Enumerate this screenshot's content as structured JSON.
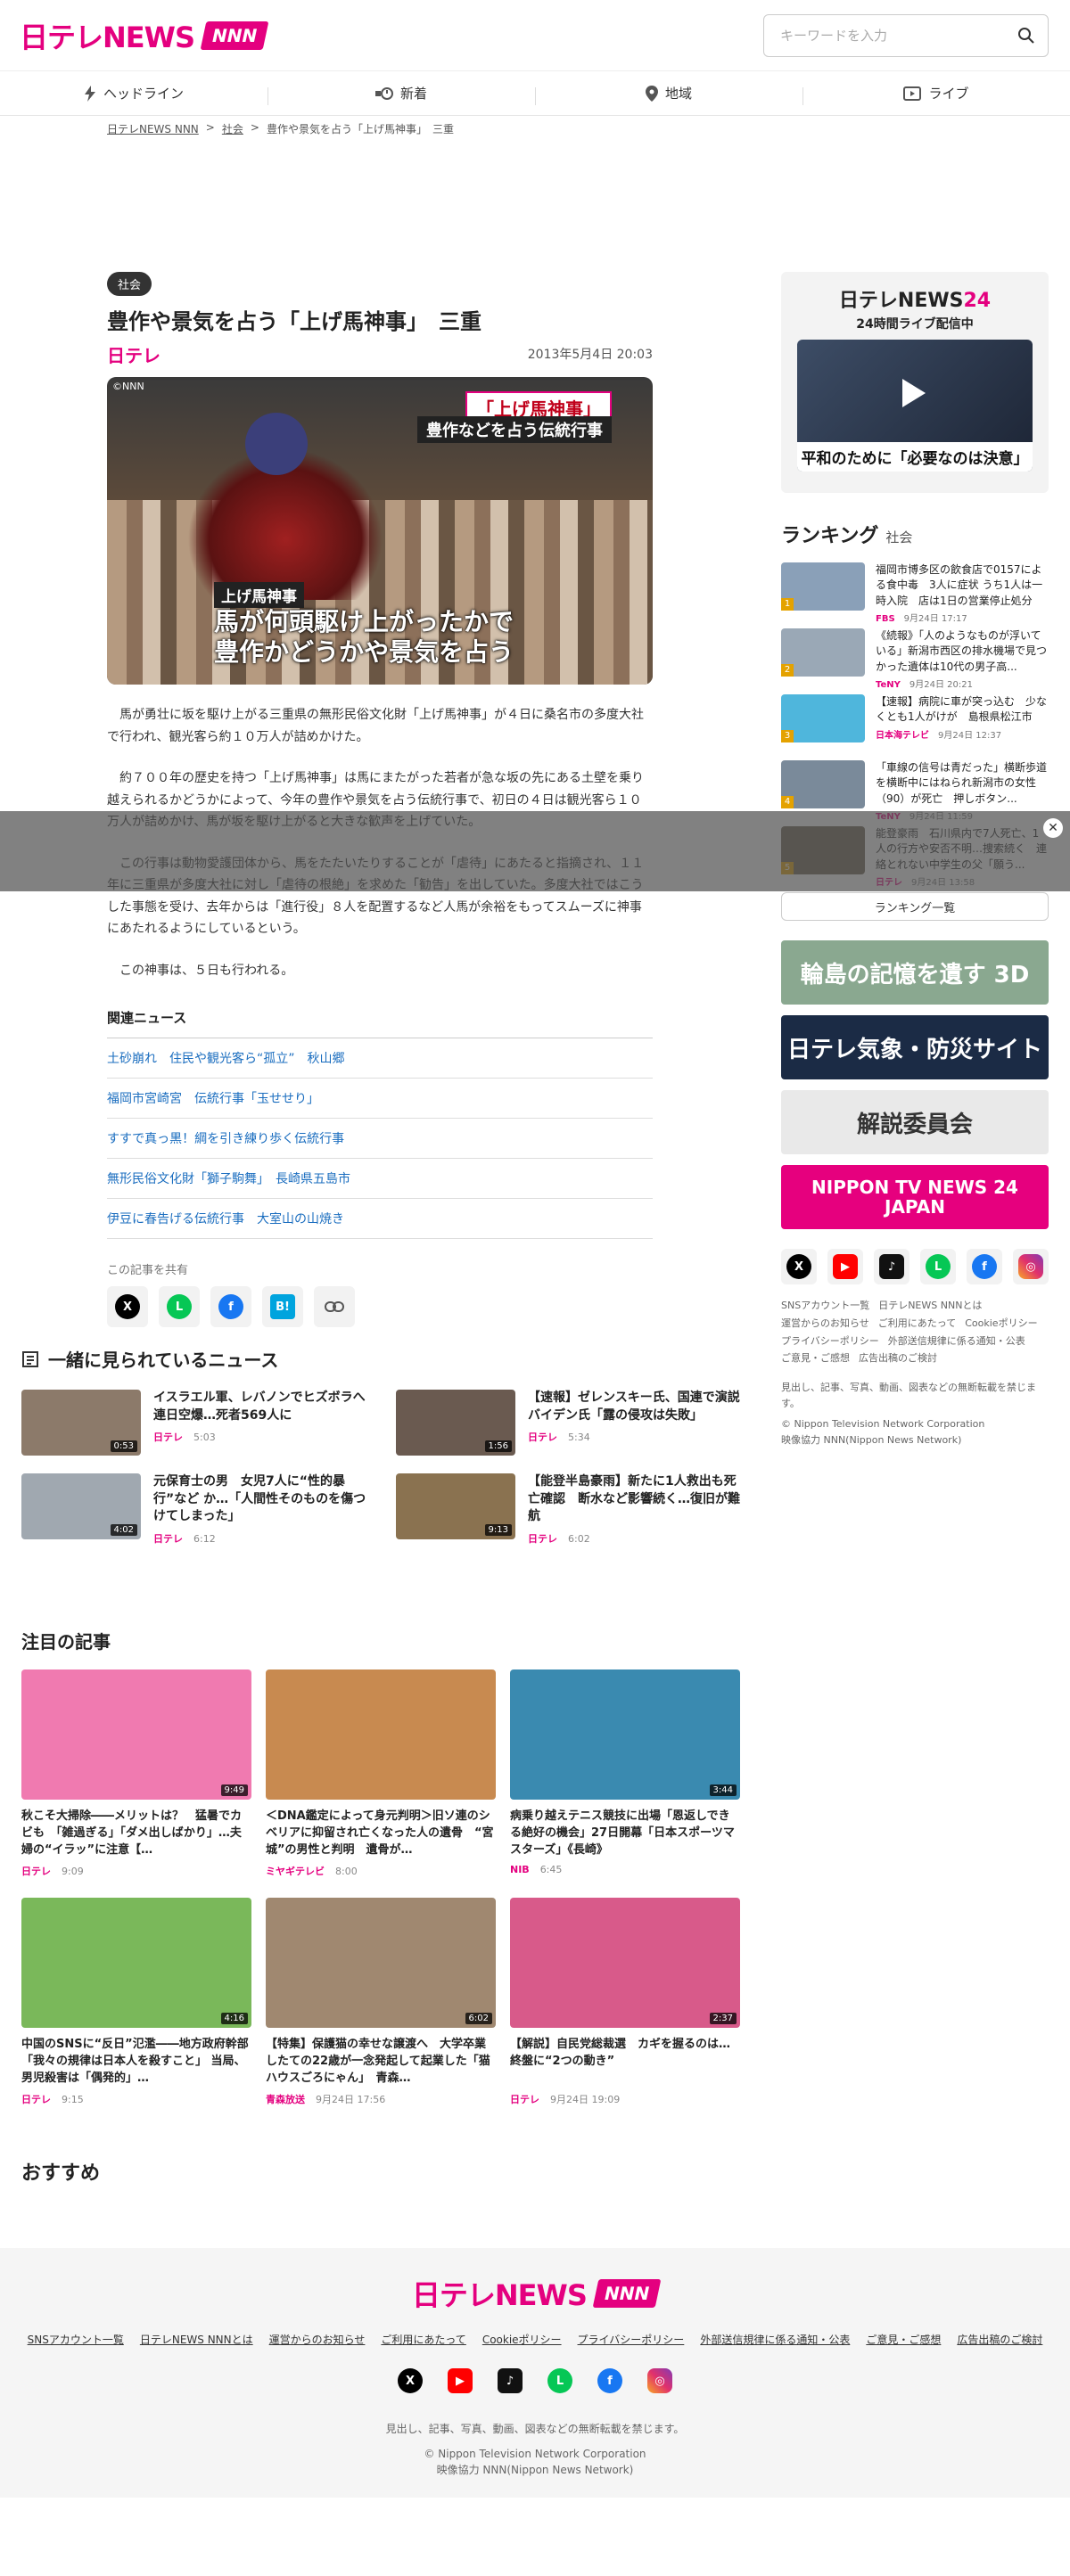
{
  "header": {
    "logo_main": "日テレNEWS",
    "logo_badge": "NNN",
    "search_placeholder": "キーワードを入力"
  },
  "nav": [
    {
      "label": "ヘッドライン",
      "icon": "lightning-icon"
    },
    {
      "label": "新着",
      "icon": "new-clock-icon"
    },
    {
      "label": "地域",
      "icon": "map-pin-icon"
    },
    {
      "label": "ライブ",
      "icon": "live-play-icon"
    }
  ],
  "breadcrumb": [
    "日テレNEWS NNN",
    "社会",
    "豊作や景気を占う「上げ馬神事」　三重"
  ],
  "article": {
    "category": "社会",
    "title": "豊作や景気を占う「上げ馬神事」　三重",
    "source_logo": "日テレ",
    "date": "2013年5月4日 20:03",
    "photo": {
      "watermark": "©NNN",
      "caption_top1": "「上げ馬神事」",
      "caption_top2": "豊作などを占う伝統行事",
      "caption_label": "上げ馬神事",
      "caption_main_1": "馬が何頭駆け上がったかで",
      "caption_main_2": "豊作かどうかや景気を占う"
    },
    "paragraphs": [
      "馬が勇壮に坂を駆け上がる三重県の無形民俗文化財「上げ馬神事」が４日に桑名市の多度大社で行われ、観光客ら約１０万人が詰めかけた。",
      "約７００年の歴史を持つ「上げ馬神事」は馬にまたがった若者が急な坂の先にある土壁を乗り越えられるかどうかによって、今年の豊作や景気を占う伝統行事で、初日の４日は観光客ら１０万人が詰めかけ、馬が坂を駆け上がると大きな歓声を上げていた。",
      "この行事は動物愛護団体から、馬をたたいたりすることが「虐待」にあたると指摘され、１１年に三重県が多度大社に対し「虐待の根絶」を求めた「勧告」を出していた。多度大社ではこうした事態を受け、去年からは「進行役」８人を配置するなど人馬が余裕をもってスムーズに神事にあたれるようにしているという。",
      "この神事は、５日も行われる。"
    ],
    "related_title": "関連ニュース",
    "related": [
      "土砂崩れ　住民や観光客ら“孤立”　秋山郷",
      "福岡市宮崎宮　伝統行事「玉せせり」",
      "すすで真っ黒！綱を引き練り歩く伝統行事",
      "無形民俗文化財「獅子駒舞」　長崎県五島市",
      "伊豆に春告げる伝統行事　大室山の山焼き"
    ],
    "share_label": "この記事を共有"
  },
  "sidebar": {
    "live_title_a": "日テレNEWS",
    "live_title_b": "24",
    "live_sub": "24時間ライブ配信中",
    "live_caption": "平和のために「必要なのは決意」",
    "ranking_title": "ランキング",
    "ranking_cat": "社会",
    "ranking": [
      {
        "no": "1",
        "text": "福岡市博多区の飲食店で0157による食中毒　3人に症状 うち1人は一時入院　店は1日の営業停止処分",
        "src": "FBS",
        "time": "9月24日 17:17",
        "color": "#8aa0b8"
      },
      {
        "no": "2",
        "text": "《続報》「人のようなものが浮いている」新潟市西区の排水機場で見つかった遺体は10代の男子高...",
        "src": "TeNY",
        "time": "9月24日 20:21",
        "color": "#9aa8b6"
      },
      {
        "no": "3",
        "text": "【速報】病院に車が突っ込む　少なくとも1人がけが　島根県松江市",
        "src": "日本海テレビ",
        "time": "9月24日 12:37",
        "color": "#4fb6dc"
      },
      {
        "no": "4",
        "text": "「車線の信号は青だった」横断歩道を横断中にはねられ新潟市の女性（90）が死亡　押しボタン...",
        "src": "TeNY",
        "time": "9月24日 11:59",
        "color": "#7a8a9a"
      },
      {
        "no": "5",
        "text": "能登豪雨　石川県内で7人死亡、1人の行方や安否不明…捜索続く　連絡とれない中学生の父「願う...",
        "src": "日テレ",
        "time": "9月24日 13:58",
        "color": "#6b6050"
      }
    ],
    "ranking_btn": "ランキング一覧",
    "banners": [
      {
        "label": "輪島の記憶を遺す 3D",
        "bg": "#8aa890",
        "fg": "#ffffff"
      },
      {
        "label": "日テレ気象・防災サイト",
        "bg": "#1b2b45",
        "fg": "#ffffff"
      },
      {
        "label": "解説委員会",
        "bg": "#e9e9e9",
        "fg": "#333333"
      },
      {
        "label": "NIPPON TV NEWS 24 JAPAN",
        "bg": "#e6007e",
        "fg": "#ffffff"
      }
    ],
    "links": [
      "SNSアカウント一覧",
      "日テレNEWS NNNとは",
      "運営からのお知らせ",
      "ご利用にあたって",
      "Cookieポリシー",
      "プライバシーポリシー",
      "外部送信規律に係る通知・公表",
      "ご意見・ご感想",
      "広告出稿のご検討"
    ],
    "notice": "見出し、記事、写真、動画、図表などの無断転載を禁じます。",
    "copyright_1": "© Nippon Television Network Corporation",
    "copyright_2": "映像協力 NNN(Nippon News Network)"
  },
  "together": {
    "title": "一緒に見られているニュース",
    "items": [
      {
        "text": "イスラエル軍、レバノンでヒズボラへ連日空爆…死者569人に",
        "src": "日テレ",
        "time": "5:03",
        "dur": "0:53",
        "color": "#8c7a6a"
      },
      {
        "text": "【速報】ゼレンスキー氏、国連で演説　バイデン氏「露の侵攻は失敗」",
        "src": "日テレ",
        "time": "5:34",
        "dur": "1:56",
        "color": "#6a5a50"
      },
      {
        "text": "元保育士の男　女児7人に“性的暴行”など か…「人間性そのものを傷つけてしまった」",
        "src": "日テレ",
        "time": "6:12",
        "dur": "4:02",
        "color": "#a0a8b0"
      },
      {
        "text": "【能登半島豪雨】新たに1人救出も死亡確認　断水など影響続く…復旧が難航",
        "src": "日テレ",
        "time": "6:02",
        "dur": "9:13",
        "color": "#8a7250"
      }
    ]
  },
  "featured": {
    "title": "注目の記事",
    "items": [
      {
        "text": "秋こそ大掃除――メリットは？　猛暑でカビも　「雑過ぎる」「ダメ出しばかり」…夫婦の“イラッ”に注意【…",
        "src": "日テレ",
        "time": "9:09",
        "dur": "9:49",
        "color": "#f07ab0"
      },
      {
        "text": "＜DNA鑑定によって身元判明＞旧ソ連のシベリアに抑留され亡くなった人の遺骨　“宮城”の男性と判明　遺骨が…",
        "src": "ミヤギテレビ",
        "time": "8:00",
        "dur": "",
        "color": "#c88a50"
      },
      {
        "text": "病乗り越えテニス競技に出場「恩返しできる絶好の機会」27日開幕「日本スポーツマスターズ」《長崎》",
        "src": "NIB",
        "time": "6:45",
        "dur": "3:44",
        "color": "#3a8ab0"
      },
      {
        "text": "中国のSNSに“反日”氾濫――地方政府幹部「我々の規律は日本人を殺すこと」 当局、男児殺害は「偶発的」…",
        "src": "日テレ",
        "time": "9:15",
        "dur": "4:16",
        "color": "#7ab85a"
      },
      {
        "text": "【特集】保護猫の幸せな譲渡へ　大学卒業したての22歳が一念発起して起業した「猫ハウスごろにゃん」　青森…",
        "src": "青森放送",
        "time": "9月24日 17:56",
        "dur": "6:02",
        "color": "#a08870"
      },
      {
        "text": "【解説】自民党総裁選　カギを握るのは…終盤に“2つの動き”",
        "src": "日テレ",
        "time": "9月24日 19:09",
        "dur": "2:37",
        "color": "#d85a8a"
      }
    ]
  },
  "reco_title": "おすすめ",
  "footer": {
    "links": [
      "SNSアカウント一覧",
      "日テレNEWS NNNとは",
      "運営からのお知らせ",
      "ご利用にあたって",
      "Cookieポリシー",
      "プライバシーポリシー",
      "外部送信規律に係る通知・公表",
      "ご意見・ご感想",
      "広告出稿のご検討"
    ],
    "notice": "見出し、記事、写真、動画、図表などの無断転載を禁じます。",
    "copyright_1": "© Nippon Television Network Corporation",
    "copyright_2": "映像協力 NNN(Nippon News Network)"
  }
}
